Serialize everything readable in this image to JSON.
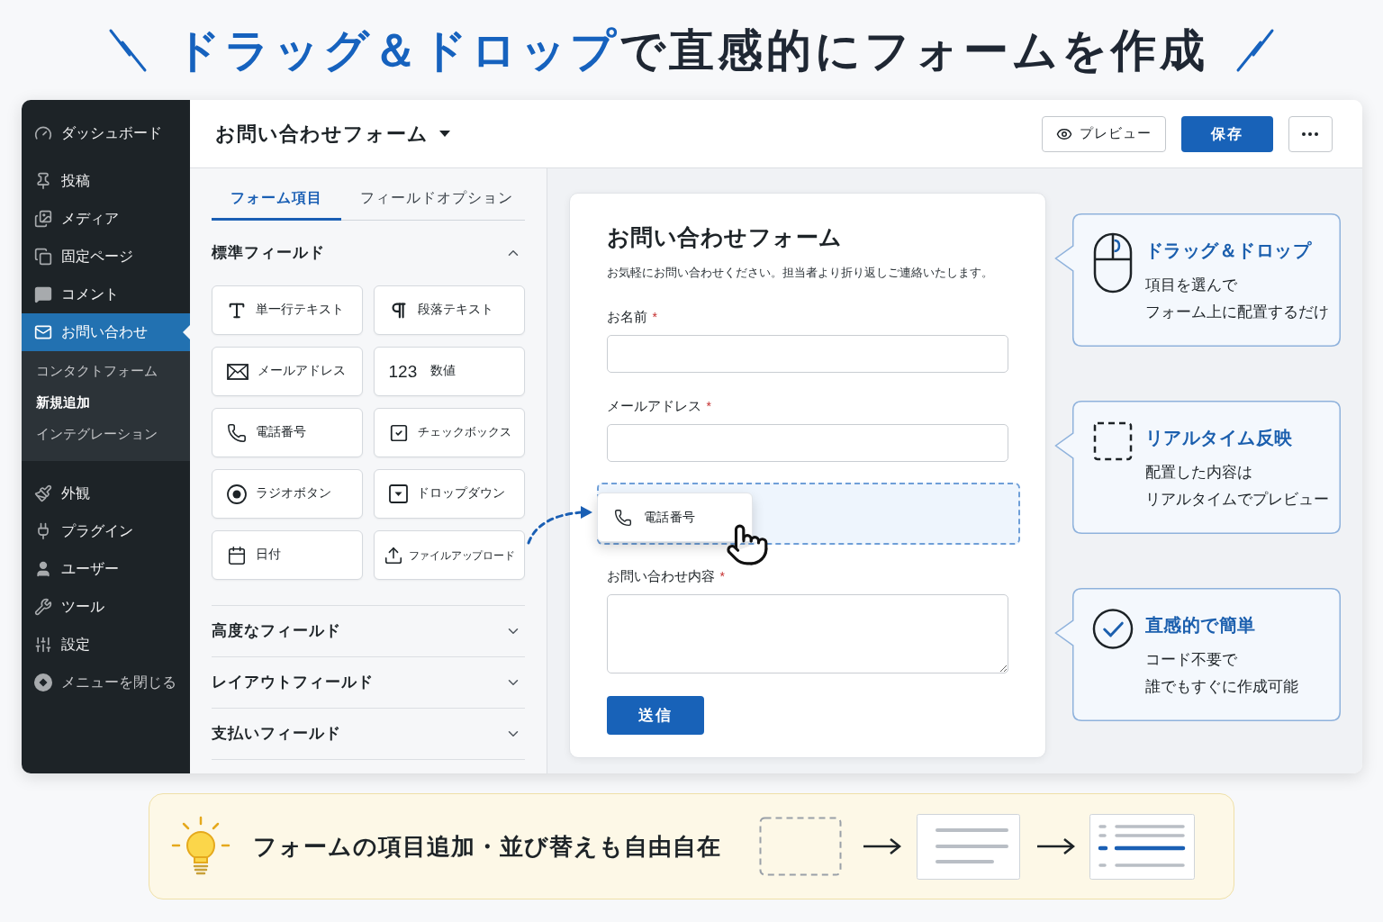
{
  "headline": {
    "highlight": "ドラッグ＆ドロップ",
    "rest": "で直感的にフォームを作成"
  },
  "sidebar": {
    "items": [
      {
        "label": "ダッシュボード",
        "kind": "dashboard",
        "selected": false
      },
      {
        "label": "投稿",
        "kind": "posts",
        "selected": false
      },
      {
        "label": "メディア",
        "kind": "media",
        "selected": false
      },
      {
        "label": "固定ページ",
        "kind": "pages",
        "selected": false
      },
      {
        "label": "コメント",
        "kind": "comments",
        "selected": false
      },
      {
        "label": "お問い合わせ",
        "kind": "contact",
        "selected": true,
        "children": [
          {
            "label": "コンタクトフォーム",
            "selected": false
          },
          {
            "label": "新規追加",
            "selected": true
          },
          {
            "label": "インテグレーション",
            "selected": false
          }
        ]
      },
      {
        "label": "外観",
        "kind": "appearance",
        "selected": false
      },
      {
        "label": "プラグイン",
        "kind": "plugins",
        "selected": false
      },
      {
        "label": "ユーザー",
        "kind": "users",
        "selected": false
      },
      {
        "label": "ツール",
        "kind": "tools",
        "selected": false
      },
      {
        "label": "設定",
        "kind": "settings",
        "selected": false
      },
      {
        "label": "メニューを閉じる",
        "kind": "collapse",
        "selected": false
      }
    ]
  },
  "top_bar": {
    "form_title": "お問い合わせフォーム",
    "buttons": [
      {
        "kind": "preview",
        "label": "プレビュー"
      },
      {
        "kind": "save",
        "label": "保存"
      },
      {
        "kind": "more"
      }
    ]
  },
  "field_panel": {
    "tabs": [
      {
        "label": "フォーム項目",
        "selected": true
      },
      {
        "label": "フィールドオプション",
        "selected": false
      }
    ],
    "sections": [
      {
        "title": "標準フィールド",
        "expanded": true,
        "items": [
          {
            "label": "単一行テキスト",
            "kind": "text"
          },
          {
            "label": "段落テキスト",
            "kind": "paragraph"
          },
          {
            "label": "メールアドレス",
            "kind": "email"
          },
          {
            "label": "数値",
            "kind": "number",
            "glyph": "123"
          },
          {
            "label": "電話番号",
            "kind": "phone"
          },
          {
            "label": "チェックボックス",
            "kind": "checkbox"
          },
          {
            "label": "ラジオボタン",
            "kind": "radio"
          },
          {
            "label": "ドロップダウン",
            "kind": "dropdown"
          },
          {
            "label": "日付",
            "kind": "date"
          },
          {
            "label": "ファイルアップロード",
            "kind": "upload"
          }
        ]
      },
      {
        "title": "高度なフィールド",
        "expanded": false
      },
      {
        "title": "レイアウトフィールド",
        "expanded": false
      },
      {
        "title": "支払いフィールド",
        "expanded": false
      }
    ]
  },
  "form_preview": {
    "title": "お問い合わせフォーム",
    "description": "お気軽にお問い合わせください。担当者より折り返しご連絡いたします。",
    "fields": [
      {
        "kind": "input",
        "label": "お名前",
        "required_mark": "*"
      },
      {
        "kind": "input",
        "label": "メールアドレス",
        "required_mark": "*"
      },
      {
        "kind": "dropzone",
        "dragged_label": "電話番号"
      },
      {
        "kind": "textarea",
        "label": "お問い合わせ内容",
        "required_mark": "*"
      }
    ],
    "submit": "送信"
  },
  "callouts": [
    {
      "kind": "mouse",
      "title": "ドラッグ＆ドロップ",
      "description_lines": [
        "項目を選んで",
        "フォーム上に配置するだけ"
      ]
    },
    {
      "kind": "dashed-square",
      "title": "リアルタイム反映",
      "description_lines": [
        "配置した内容は",
        "リアルタイムでプレビュー"
      ]
    },
    {
      "kind": "check",
      "title": "直感的で簡単",
      "description_lines": [
        "コード不要で",
        "誰でもすぐに作成可能"
      ]
    }
  ],
  "tip_banner": {
    "text": "フォームの項目追加・並び替えも自由自在"
  }
}
